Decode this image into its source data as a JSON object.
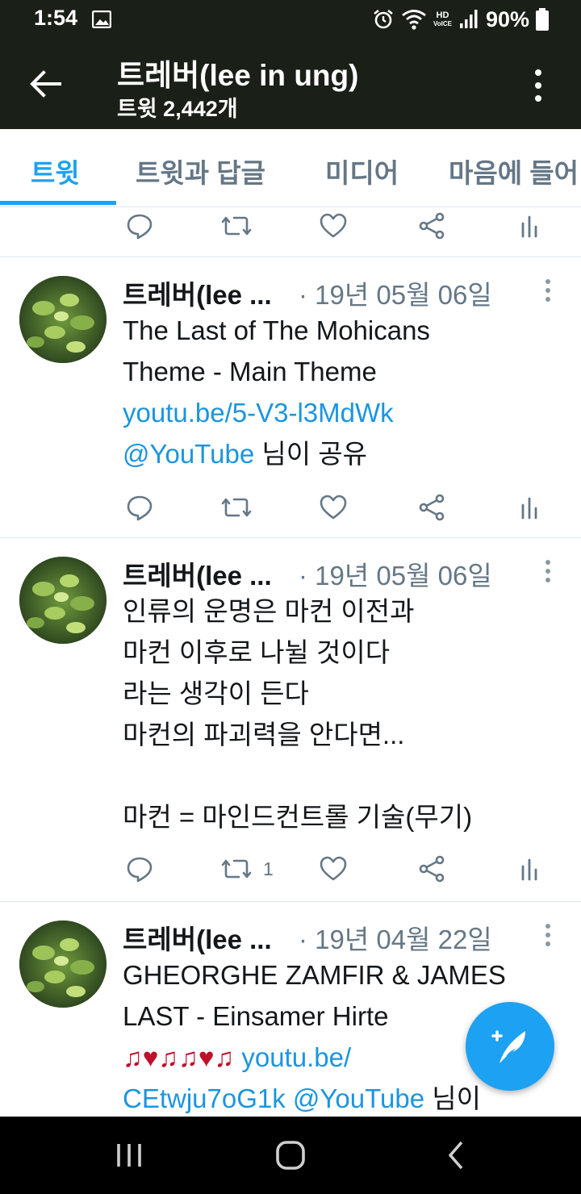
{
  "status_bar": {
    "time": "1:54",
    "battery": "90%",
    "hd_label": "HD",
    "voice_label": "VoICE",
    "icons": [
      "image-icon",
      "alarm-icon",
      "wifi-icon",
      "signal-icon",
      "battery-icon"
    ]
  },
  "app_bar": {
    "title": "트레버(lee in ung)",
    "subtitle": "트윗 2,442개"
  },
  "tabs": [
    {
      "label": "트윗",
      "active": true
    },
    {
      "label": "트윗과 답글",
      "active": false
    },
    {
      "label": "미디어",
      "active": false
    },
    {
      "label": "마음에 들어",
      "active": false
    }
  ],
  "top_actions": {
    "retweets": "",
    "likes": ""
  },
  "tweets": [
    {
      "name": "트레버(lee ...",
      "date": "· 19년 05월 06일",
      "lines": [
        {
          "text": "The Last of The Mohicans"
        },
        {
          "text": "Theme - Main Theme"
        },
        {
          "link": "youtu.be/5-V3-l3MdWk"
        },
        {
          "link": "@YouTube",
          "text": " 님이 공유"
        }
      ],
      "retweets": "",
      "likes": ""
    },
    {
      "name": "트레버(lee ...",
      "date": "· 19년 05월 06일",
      "lines": [
        {
          "text": "인류의 운명은 마컨 이전과"
        },
        {
          "text": "마컨 이후로 나뉠 것이다"
        },
        {
          "text": "라는 생각이 든다"
        },
        {
          "text": "마컨의 파괴력을 안다면..."
        },
        {
          "text": ""
        },
        {
          "text": "마컨 = 마인드컨트롤 기술(무기)"
        }
      ],
      "retweets": "1",
      "likes": ""
    },
    {
      "name": "트레버(lee ...",
      "date": "· 19년 04월 22일",
      "lines": [
        {
          "text": "GHEORGHE ZAMFIR & JAMES"
        },
        {
          "text": "LAST - Einsamer Hirte"
        },
        {
          "emoji": "♫♥♫♫♥♫",
          "link": " youtu.be/"
        },
        {
          "link": "CEtwju7oG1k @YouTube",
          "text": " 님이"
        }
      ]
    }
  ],
  "colors": {
    "header_bg": "#1a1f17",
    "accent": "#1da1f2",
    "link": "#1b95e0",
    "muted": "#657786",
    "text": "#14171a",
    "heart": "#c0102a"
  }
}
